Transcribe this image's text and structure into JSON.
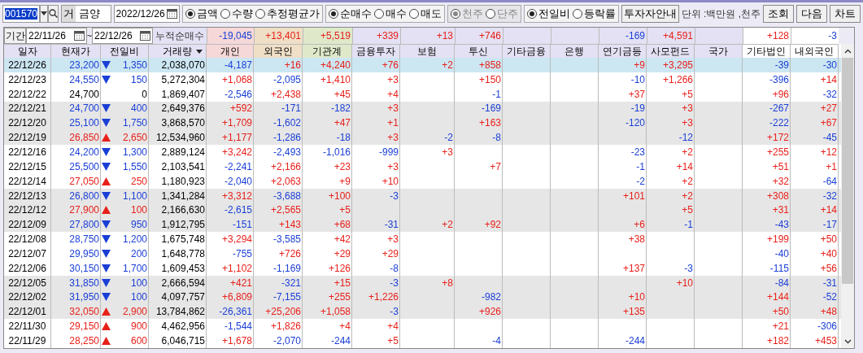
{
  "toolbar": {
    "stock_code": "001570",
    "market_badge": "거",
    "stock_name": "금양",
    "date": "2022/12/26",
    "radio_groups": [
      {
        "disabled": false,
        "options": [
          {
            "label": "금액",
            "selected": true
          },
          {
            "label": "수량",
            "selected": false
          },
          {
            "label": "추정평균가",
            "selected": false
          }
        ]
      },
      {
        "disabled": false,
        "options": [
          {
            "label": "순매수",
            "selected": true
          },
          {
            "label": "매수",
            "selected": false
          },
          {
            "label": "매도",
            "selected": false
          }
        ]
      },
      {
        "disabled": true,
        "options": [
          {
            "label": "천주",
            "selected": true
          },
          {
            "label": "단주",
            "selected": false
          }
        ]
      },
      {
        "disabled": false,
        "options": [
          {
            "label": "전일비",
            "selected": true
          },
          {
            "label": "등락률",
            "selected": false
          }
        ]
      }
    ],
    "guide_button": "투자자안내",
    "unit_label": "단위 :백만원 ,천주",
    "buttons": [
      "조회",
      "다음",
      "차트"
    ]
  },
  "period": {
    "label": "기간",
    "from": "22/11/26",
    "separator": "~",
    "to": "22/12/26",
    "cumulative_label": "누적순매수"
  },
  "cumulative": [
    {
      "value": "-19,045",
      "color": "#f6d8d8"
    },
    {
      "value": "+13,401",
      "color": "#efdfc6"
    },
    {
      "value": "+5,519",
      "color": "#dfe9ca"
    },
    {
      "value": "+339",
      "color": "#e3e1f3"
    },
    {
      "value": "+13",
      "color": "#e3e1f3"
    },
    {
      "value": "+746",
      "color": "#e3e1f3"
    },
    {
      "color": "#e3e1f3"
    },
    {
      "color": "#e3e1f3"
    },
    {
      "value": "-169",
      "color": "#e3e1f3"
    },
    {
      "value": "+4,591",
      "color": "#e3e1f3"
    },
    {
      "color": "#e3e1f3"
    },
    {
      "value": "+128",
      "color": "#ffffff"
    },
    {
      "value": "-3",
      "color": "#ffffff"
    }
  ],
  "table": {
    "columns": [
      {
        "label": "일자",
        "color": "#e3e1f3",
        "dropdown": false
      },
      {
        "label": "현재가",
        "color": "#e3e1f3",
        "dropdown": false
      },
      {
        "label": "전일비",
        "color": "#e3e1f3",
        "dropdown": false
      },
      {
        "label": "거래량",
        "color": "#e3e1f3",
        "dropdown": true
      },
      {
        "label": "개인",
        "color": "#f6d8d8",
        "dropdown": false
      },
      {
        "label": "외국인",
        "color": "#efdfc6",
        "dropdown": false
      },
      {
        "label": "기관계",
        "color": "#dfe9ca",
        "dropdown": false
      },
      {
        "label": "금융투자",
        "color": "#e3e1f3",
        "dropdown": false
      },
      {
        "label": "보험",
        "color": "#e3e1f3",
        "dropdown": false
      },
      {
        "label": "투신",
        "color": "#e3e1f3",
        "dropdown": false
      },
      {
        "label": "기타금융",
        "color": "#e3e1f3",
        "dropdown": false
      },
      {
        "label": "은행",
        "color": "#e3e1f3",
        "dropdown": false
      },
      {
        "label": "연기금등",
        "color": "#e3e1f3",
        "dropdown": false
      },
      {
        "label": "사모펀드",
        "color": "#e3e1f3",
        "dropdown": false
      },
      {
        "label": "국가",
        "color": "#e3e1f3",
        "dropdown": false
      },
      {
        "label": "기타법인",
        "color": "#ffffff",
        "dropdown": false
      },
      {
        "label": "내외국인",
        "color": "#ffffff",
        "dropdown": false
      }
    ],
    "rows": [
      {
        "selected": true,
        "date": "22/12/26",
        "price": "23,200",
        "rising": false,
        "falling": true,
        "diff": "1,350",
        "volume": "2,038,070",
        "investors": {
          "individual": "-4,187",
          "foreign": "+16",
          "institution": "+4,240",
          "fin_invest": "+76",
          "insurance": "+2",
          "trust": "+858",
          "pension": "+9",
          "private_fund": "+3,295",
          "other_corp": "-39",
          "domestic_foreign": "-30"
        }
      },
      {
        "selected": false,
        "date": "22/12/23",
        "price": "24,550",
        "rising": false,
        "falling": true,
        "diff": "150",
        "volume": "5,272,304",
        "investors": {
          "individual": "+1,068",
          "foreign": "-2,095",
          "institution": "+1,410",
          "fin_invest": "+3",
          "trust": "+150",
          "pension": "-10",
          "private_fund": "+1,266",
          "other_corp": "-396",
          "domestic_foreign": "+14"
        }
      },
      {
        "selected": false,
        "date": "22/12/22",
        "price": "24,700",
        "rising": false,
        "falling": false,
        "diff": "0",
        "volume": "1,869,407",
        "investors": {
          "individual": "-2,546",
          "foreign": "+2,438",
          "institution": "+45",
          "fin_invest": "+4",
          "trust": "-1",
          "pension": "+37",
          "private_fund": "+5",
          "other_corp": "+96",
          "domestic_foreign": "-32"
        }
      },
      {
        "selected": false,
        "date": "22/12/21",
        "price": "24,700",
        "rising": false,
        "falling": true,
        "diff": "400",
        "volume": "2,649,376",
        "investors": {
          "individual": "+592",
          "foreign": "-171",
          "institution": "-182",
          "fin_invest": "+3",
          "trust": "-169",
          "pension": "-19",
          "private_fund": "+3",
          "other_corp": "-267",
          "domestic_foreign": "+27"
        }
      },
      {
        "selected": false,
        "date": "22/12/20",
        "price": "25,100",
        "rising": false,
        "falling": true,
        "diff": "1,750",
        "volume": "3,868,570",
        "investors": {
          "individual": "+1,709",
          "foreign": "-1,602",
          "institution": "+47",
          "fin_invest": "+1",
          "trust": "+163",
          "pension": "-120",
          "private_fund": "+3",
          "other_corp": "-222",
          "domestic_foreign": "+67"
        }
      },
      {
        "selected": false,
        "date": "22/12/19",
        "price": "26,850",
        "rising": true,
        "falling": false,
        "diff": "2,650",
        "volume": "12,534,960",
        "investors": {
          "individual": "+1,177",
          "foreign": "-1,286",
          "institution": "-18",
          "fin_invest": "+3",
          "insurance": "-2",
          "trust": "-8",
          "private_fund": "-12",
          "other_corp": "+172",
          "domestic_foreign": "-45"
        }
      },
      {
        "selected": false,
        "date": "22/12/16",
        "price": "24,200",
        "rising": false,
        "falling": true,
        "diff": "1,300",
        "volume": "2,889,124",
        "investors": {
          "individual": "+3,242",
          "foreign": "-2,493",
          "institution": "-1,016",
          "fin_invest": "-999",
          "insurance": "+3",
          "pension": "-23",
          "private_fund": "+2",
          "other_corp": "+255",
          "domestic_foreign": "+12"
        }
      },
      {
        "selected": false,
        "date": "22/12/15",
        "price": "25,500",
        "rising": false,
        "falling": true,
        "diff": "1,550",
        "volume": "2,103,541",
        "investors": {
          "individual": "-2,241",
          "foreign": "+2,166",
          "institution": "+23",
          "fin_invest": "+3",
          "trust": "+7",
          "pension": "-1",
          "private_fund": "+14",
          "other_corp": "+51",
          "domestic_foreign": "+1"
        }
      },
      {
        "selected": false,
        "date": "22/12/14",
        "price": "27,050",
        "rising": true,
        "falling": false,
        "diff": "250",
        "volume": "1,180,923",
        "investors": {
          "individual": "-2,040",
          "foreign": "+2,063",
          "institution": "+9",
          "fin_invest": "+10",
          "pension": "-2",
          "private_fund": "+2",
          "other_corp": "+32",
          "domestic_foreign": "-64"
        }
      },
      {
        "selected": false,
        "date": "22/12/13",
        "price": "26,800",
        "rising": false,
        "falling": true,
        "diff": "1,100",
        "volume": "1,341,284",
        "investors": {
          "individual": "+3,312",
          "foreign": "-3,688",
          "institution": "+100",
          "fin_invest": "-3",
          "pension": "+101",
          "private_fund": "+2",
          "other_corp": "+308",
          "domestic_foreign": "-32"
        }
      },
      {
        "selected": false,
        "date": "22/12/12",
        "price": "27,900",
        "rising": true,
        "falling": false,
        "diff": "100",
        "volume": "2,166,630",
        "investors": {
          "individual": "-2,615",
          "foreign": "+2,565",
          "institution": "+5",
          "private_fund": "+5",
          "other_corp": "+31",
          "domestic_foreign": "+14"
        }
      },
      {
        "selected": false,
        "date": "22/12/09",
        "price": "27,800",
        "rising": false,
        "falling": true,
        "diff": "950",
        "volume": "1,912,795",
        "investors": {
          "individual": "-151",
          "foreign": "+143",
          "institution": "+68",
          "fin_invest": "-31",
          "insurance": "+2",
          "trust": "+92",
          "pension": "+6",
          "private_fund": "-1",
          "other_corp": "-43",
          "domestic_foreign": "-17"
        }
      },
      {
        "selected": false,
        "date": "22/12/08",
        "price": "28,750",
        "rising": false,
        "falling": true,
        "diff": "1,200",
        "volume": "1,675,748",
        "investors": {
          "individual": "+3,294",
          "foreign": "-3,585",
          "institution": "+42",
          "fin_invest": "+3",
          "pension": "+38",
          "other_corp": "+199",
          "domestic_foreign": "+50"
        }
      },
      {
        "selected": false,
        "date": "22/12/07",
        "price": "29,950",
        "rising": false,
        "falling": true,
        "diff": "200",
        "volume": "1,648,778",
        "investors": {
          "individual": "-755",
          "foreign": "+726",
          "institution": "+29",
          "fin_invest": "+29",
          "other_corp": "-40",
          "domestic_foreign": "+40"
        }
      },
      {
        "selected": false,
        "date": "22/12/06",
        "price": "30,150",
        "rising": false,
        "falling": true,
        "diff": "1,700",
        "volume": "1,609,453",
        "investors": {
          "individual": "+1,102",
          "foreign": "-1,169",
          "institution": "+126",
          "fin_invest": "-8",
          "pension": "+137",
          "private_fund": "-3",
          "other_corp": "-115",
          "domestic_foreign": "+56"
        }
      },
      {
        "selected": false,
        "date": "22/12/05",
        "price": "31,850",
        "rising": false,
        "falling": true,
        "diff": "100",
        "volume": "2,666,594",
        "investors": {
          "individual": "+421",
          "foreign": "-321",
          "institution": "+15",
          "fin_invest": "-3",
          "insurance": "+8",
          "private_fund": "+10",
          "other_corp": "-84",
          "domestic_foreign": "-31"
        }
      },
      {
        "selected": false,
        "date": "22/12/02",
        "price": "31,950",
        "rising": false,
        "falling": true,
        "diff": "100",
        "volume": "4,097,757",
        "investors": {
          "individual": "+6,809",
          "foreign": "-7,155",
          "institution": "+255",
          "fin_invest": "+1,226",
          "trust": "-982",
          "pension": "+10",
          "other_corp": "+144",
          "domestic_foreign": "-52"
        }
      },
      {
        "selected": false,
        "date": "22/12/01",
        "price": "32,050",
        "rising": true,
        "falling": false,
        "diff": "2,900",
        "volume": "13,784,862",
        "investors": {
          "individual": "-26,361",
          "foreign": "+25,206",
          "institution": "+1,058",
          "fin_invest": "-3",
          "trust": "+926",
          "pension": "+135",
          "other_corp": "+50",
          "domestic_foreign": "+48"
        }
      },
      {
        "selected": false,
        "date": "22/11/30",
        "price": "29,150",
        "rising": true,
        "falling": false,
        "diff": "900",
        "volume": "4,462,956",
        "investors": {
          "individual": "-1,544",
          "foreign": "+1,826",
          "institution": "+4",
          "fin_invest": "+4",
          "other_corp": "+21",
          "domestic_foreign": "-306"
        }
      },
      {
        "selected": false,
        "date": "22/11/29",
        "price": "28,250",
        "rising": true,
        "falling": false,
        "diff": "600",
        "volume": "6,046,715",
        "investors": {
          "individual": "+1,678",
          "foreign": "-2,070",
          "institution": "-244",
          "fin_invest": "+5",
          "trust": "-4",
          "pension": "-244",
          "other_corp": "+182",
          "domestic_foreign": "+453"
        }
      }
    ]
  }
}
